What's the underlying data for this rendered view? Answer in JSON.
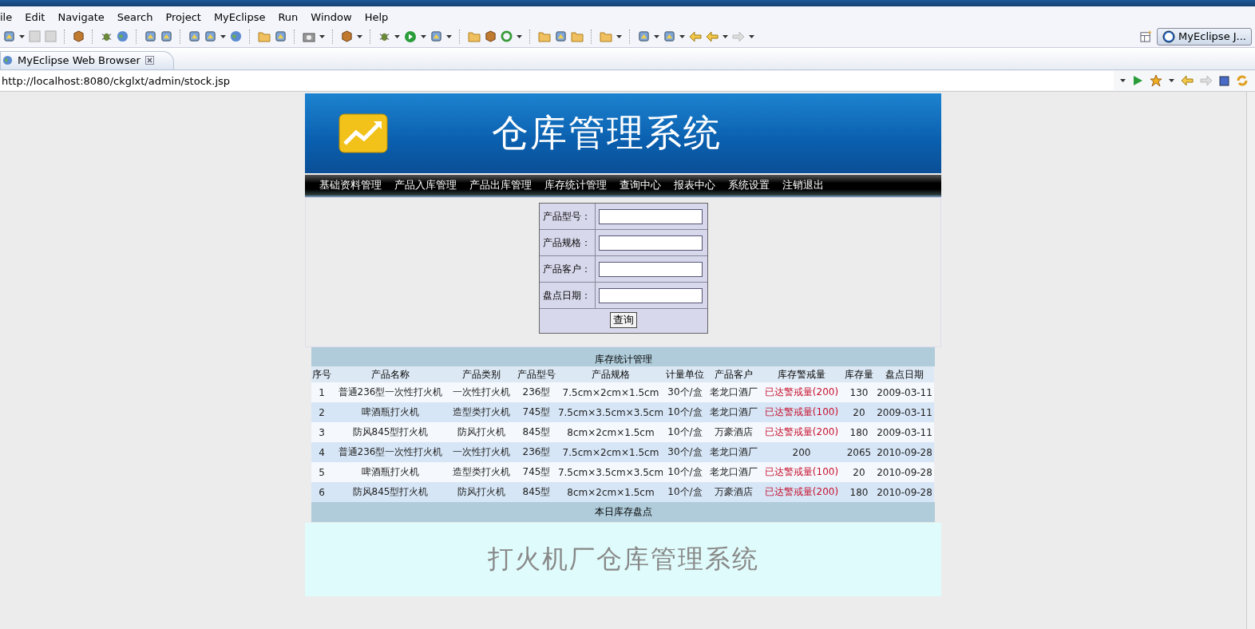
{
  "menu": [
    "ile",
    "Edit",
    "Navigate",
    "Search",
    "Project",
    "MyEclipse",
    "Run",
    "Window",
    "Help"
  ],
  "perspective": {
    "label": "MyEclipse J..."
  },
  "editor_tab": {
    "label": "MyEclipse Web Browser"
  },
  "address_bar": {
    "value": "http://localhost:8080/ckglxt/admin/stock.jsp"
  },
  "page": {
    "banner_title": "仓库管理系统",
    "nav": [
      "基础资料管理",
      "产品入库管理",
      "产品出库管理",
      "库存统计管理",
      "查询中心",
      "报表中心",
      "系统设置",
      "注销退出"
    ],
    "search_form": {
      "fields": [
        {
          "label": "产品型号："
        },
        {
          "label": "产品规格："
        },
        {
          "label": "产品客户："
        },
        {
          "label": "盘点日期："
        }
      ],
      "button": "查询"
    },
    "table": {
      "title": "库存统计管理",
      "columns": [
        "序号",
        "产品名称",
        "产品类别",
        "产品型号",
        "产品规格",
        "计量单位",
        "产品客户",
        "库存警戒量",
        "库存量",
        "盘点日期"
      ],
      "rows": [
        {
          "cells": [
            "1",
            "普通236型一次性打火机",
            "一次性打火机",
            "236型",
            "7.5cm×2cm×1.5cm",
            "30个/盒",
            "老龙口酒厂",
            "已达警戒量(200)",
            "130",
            "2009-03-11"
          ],
          "alert": true
        },
        {
          "cells": [
            "2",
            "啤酒瓶打火机",
            "造型类打火机",
            "745型",
            "7.5cm×3.5cm×3.5cm",
            "10个/盒",
            "老龙口酒厂",
            "已达警戒量(100)",
            "20",
            "2009-03-11"
          ],
          "alert": true
        },
        {
          "cells": [
            "3",
            "防风845型打火机",
            "防风打火机",
            "845型",
            "8cm×2cm×1.5cm",
            "10个/盒",
            "万豪酒店",
            "已达警戒量(200)",
            "180",
            "2009-03-11"
          ],
          "alert": true
        },
        {
          "cells": [
            "4",
            "普通236型一次性打火机",
            "一次性打火机",
            "236型",
            "7.5cm×2cm×1.5cm",
            "30个/盒",
            "老龙口酒厂",
            "200",
            "2065",
            "2010-09-28"
          ],
          "alert": false
        },
        {
          "cells": [
            "5",
            "啤酒瓶打火机",
            "造型类打火机",
            "745型",
            "7.5cm×3.5cm×3.5cm",
            "10个/盒",
            "老龙口酒厂",
            "已达警戒量(100)",
            "20",
            "2010-09-28"
          ],
          "alert": true
        },
        {
          "cells": [
            "6",
            "防风845型打火机",
            "防风打火机",
            "845型",
            "8cm×2cm×1.5cm",
            "10个/盒",
            "万豪酒店",
            "已达警戒量(200)",
            "180",
            "2010-09-28"
          ],
          "alert": true
        }
      ],
      "footer": "本日库存盘点"
    },
    "footer": "打火机厂仓库管理系统"
  }
}
